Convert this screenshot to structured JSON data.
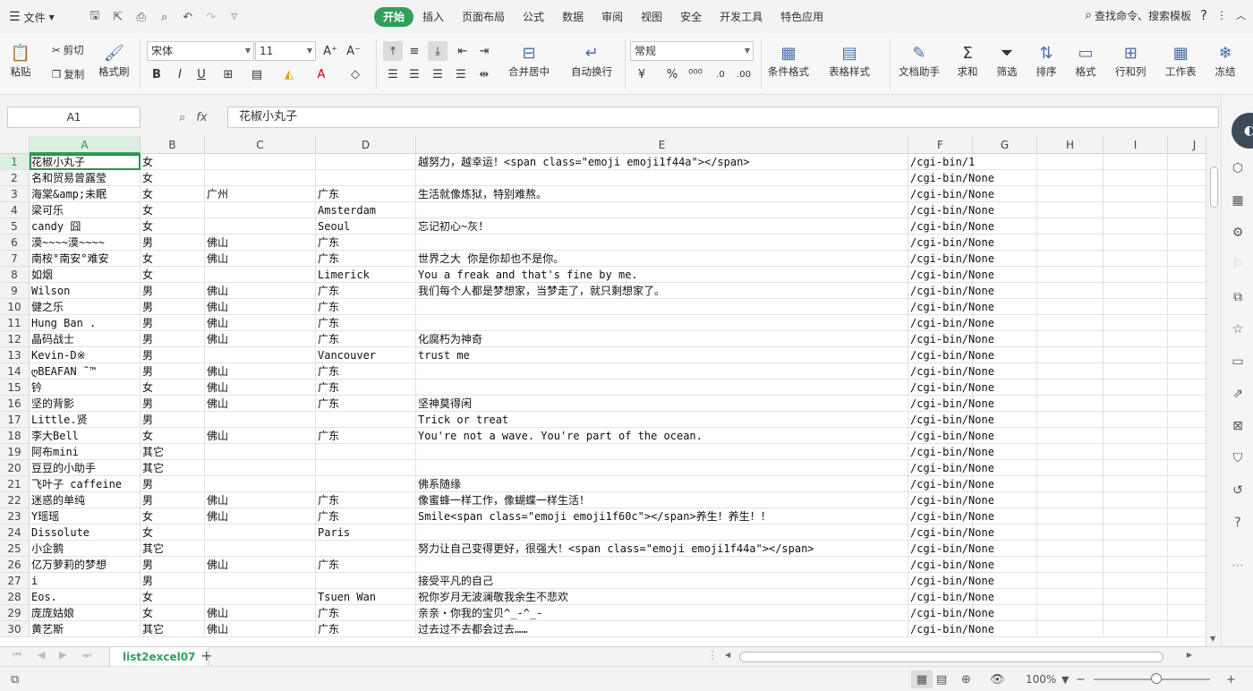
{
  "menubar": {
    "file_label": "文件",
    "tabs": [
      "开始",
      "插入",
      "页面布局",
      "公式",
      "数据",
      "审阅",
      "视图",
      "安全",
      "开发工具",
      "特色应用"
    ],
    "search_label": "查找命令、搜索模板"
  },
  "ribbon": {
    "paste": "粘贴",
    "cut": "剪切",
    "copy": "复制",
    "format_painter": "格式刷",
    "font_name": "宋体",
    "font_size": "11",
    "merge_center": "合并居中",
    "auto_wrap": "自动换行",
    "number_format": "常规",
    "conditional_format": "条件格式",
    "table_style": "表格样式",
    "doc_assistant": "文档助手",
    "sum": "求和",
    "filter": "筛选",
    "sort": "排序",
    "format": "格式",
    "rows_cols": "行和列",
    "worksheet": "工作表",
    "freeze": "冻结"
  },
  "formula_bar": {
    "name_box": "A1",
    "fx": "fx",
    "content": "花椒小丸子"
  },
  "columns": [
    "A",
    "B",
    "C",
    "D",
    "E",
    "F",
    "G",
    "H",
    "I",
    "J"
  ],
  "rows": [
    {
      "n": "1",
      "a": "花椒小丸子",
      "b": "女",
      "c": "",
      "d": "",
      "e": "越努力，越幸运！<span class=\"emoji emoji1f44a\"></span>",
      "f": "/cgi-bin/1"
    },
    {
      "n": "2",
      "a": "名和贸易曾露莹",
      "b": "女",
      "c": "",
      "d": "",
      "e": "",
      "f": "/cgi-bin/None"
    },
    {
      "n": "3",
      "a": "海棠&amp;未眠",
      "b": "女",
      "c": "广州",
      "d": "广东",
      "e": "生活就像炼狱，特别难熬。",
      "f": "/cgi-bin/None"
    },
    {
      "n": "4",
      "a": "梁可乐",
      "b": "女",
      "c": "",
      "d": "Amsterdam",
      "e": "",
      "f": "/cgi-bin/None"
    },
    {
      "n": "5",
      "a": "candy 囧",
      "b": "女",
      "c": "",
      "d": "Seoul",
      "e": "忘记初心~灰！",
      "f": "/cgi-bin/None"
    },
    {
      "n": "6",
      "a": "漠~~~~漠~~~~",
      "b": "男",
      "c": "佛山",
      "d": "广东",
      "e": "",
      "f": "/cgi-bin/None"
    },
    {
      "n": "7",
      "a": "南桉°南安°难安",
      "b": "女",
      "c": "佛山",
      "d": "广东",
      "e": "世界之大 你是你却也不是你。",
      "f": "/cgi-bin/None"
    },
    {
      "n": "8",
      "a": "如烟",
      "b": "女",
      "c": "",
      "d": "Limerick",
      "e": "You a freak and that's fine by me.",
      "f": "/cgi-bin/None"
    },
    {
      "n": "9",
      "a": "Wilson",
      "b": "男",
      "c": "佛山",
      "d": "广东",
      "e": "我们每个人都是梦想家，当梦走了，就只剩想家了。",
      "f": "/cgi-bin/None"
    },
    {
      "n": "10",
      "a": "健之乐",
      "b": "男",
      "c": "佛山",
      "d": "广东",
      "e": "",
      "f": "/cgi-bin/None"
    },
    {
      "n": "11",
      "a": "Hung Ban .",
      "b": "男",
      "c": "佛山",
      "d": "广东",
      "e": "",
      "f": "/cgi-bin/None"
    },
    {
      "n": "12",
      "a": "晶码战士",
      "b": "男",
      "c": "佛山",
      "d": "广东",
      "e": "化腐朽为神奇",
      "f": "/cgi-bin/None"
    },
    {
      "n": "13",
      "a": "Kevin-D※",
      "b": "男",
      "c": "",
      "d": "Vancouver",
      "e": "trust me",
      "f": "/cgi-bin/None"
    },
    {
      "n": "14",
      "a": "ღBEAFAN ˜™",
      "b": "男",
      "c": "佛山",
      "d": "广东",
      "e": "",
      "f": "/cgi-bin/None"
    },
    {
      "n": "15",
      "a": "钤",
      "b": "女",
      "c": "佛山",
      "d": "广东",
      "e": "",
      "f": "/cgi-bin/None"
    },
    {
      "n": "16",
      "a": "坚的背影",
      "b": "男",
      "c": "佛山",
      "d": "广东",
      "e": "坚神莫得闲",
      "f": "/cgi-bin/None"
    },
    {
      "n": "17",
      "a": "Little.贤",
      "b": "男",
      "c": "",
      "d": "",
      "e": "Trick or treat",
      "f": "/cgi-bin/None"
    },
    {
      "n": "18",
      "a": "李大Bell",
      "b": "女",
      "c": "佛山",
      "d": "广东",
      "e": "You're not a wave. You're part of the ocean.",
      "f": "/cgi-bin/None"
    },
    {
      "n": "19",
      "a": "阿布mini",
      "b": "其它",
      "c": "",
      "d": "",
      "e": "",
      "f": "/cgi-bin/None"
    },
    {
      "n": "20",
      "a": "豆豆的小助手",
      "b": "其它",
      "c": "",
      "d": "",
      "e": "",
      "f": "/cgi-bin/None"
    },
    {
      "n": "21",
      "a": "飞叶子  caffeine",
      "b": "男",
      "c": "",
      "d": "",
      "e": "佛系随缘",
      "f": "/cgi-bin/None"
    },
    {
      "n": "22",
      "a": "迷惑的单纯",
      "b": "男",
      "c": "佛山",
      "d": "广东",
      "e": "像蜜蜂一样工作，像蝴蝶一样生活！",
      "f": "/cgi-bin/None"
    },
    {
      "n": "23",
      "a": "Y瑶瑶",
      "b": "女",
      "c": "佛山",
      "d": "广东",
      "e": "Smile<span class=\"emoji emoji1f60c\"></span>养生！养生！！",
      "f": "/cgi-bin/None"
    },
    {
      "n": "24",
      "a": "Dissolute",
      "b": "女",
      "c": "",
      "d": "Paris",
      "e": "",
      "f": "/cgi-bin/None"
    },
    {
      "n": "25",
      "a": "小企鹅",
      "b": "其它",
      "c": "",
      "d": "",
      "e": "努力让自己变得更好，很强大！<span class=\"emoji emoji1f44a\"></span>",
      "f": "/cgi-bin/None"
    },
    {
      "n": "26",
      "a": "亿万萝莉的梦想",
      "b": "男",
      "c": "佛山",
      "d": "广东",
      "e": "",
      "f": "/cgi-bin/None"
    },
    {
      "n": "27",
      "a": "i",
      "b": "男",
      "c": "",
      "d": "",
      "e": "接受平凡的自己",
      "f": "/cgi-bin/None"
    },
    {
      "n": "28",
      "a": "Eos.",
      "b": "女",
      "c": "",
      "d": "Tsuen Wan",
      "e": "祝你岁月无波澜敬我余生不悲欢",
      "f": "/cgi-bin/None"
    },
    {
      "n": "29",
      "a": "庞庞姑娘",
      "b": "女",
      "c": "佛山",
      "d": "广东",
      "e": "亲亲・你我的宝贝^_-^_-",
      "f": "/cgi-bin/None"
    },
    {
      "n": "30",
      "a": "黄艺斯",
      "b": "其它",
      "c": "佛山",
      "d": "广东",
      "e": "过去过不去都会过去……",
      "f": "/cgi-bin/None"
    }
  ],
  "sheet_tab": "list2excel07",
  "status": {
    "zoom": "100%"
  }
}
